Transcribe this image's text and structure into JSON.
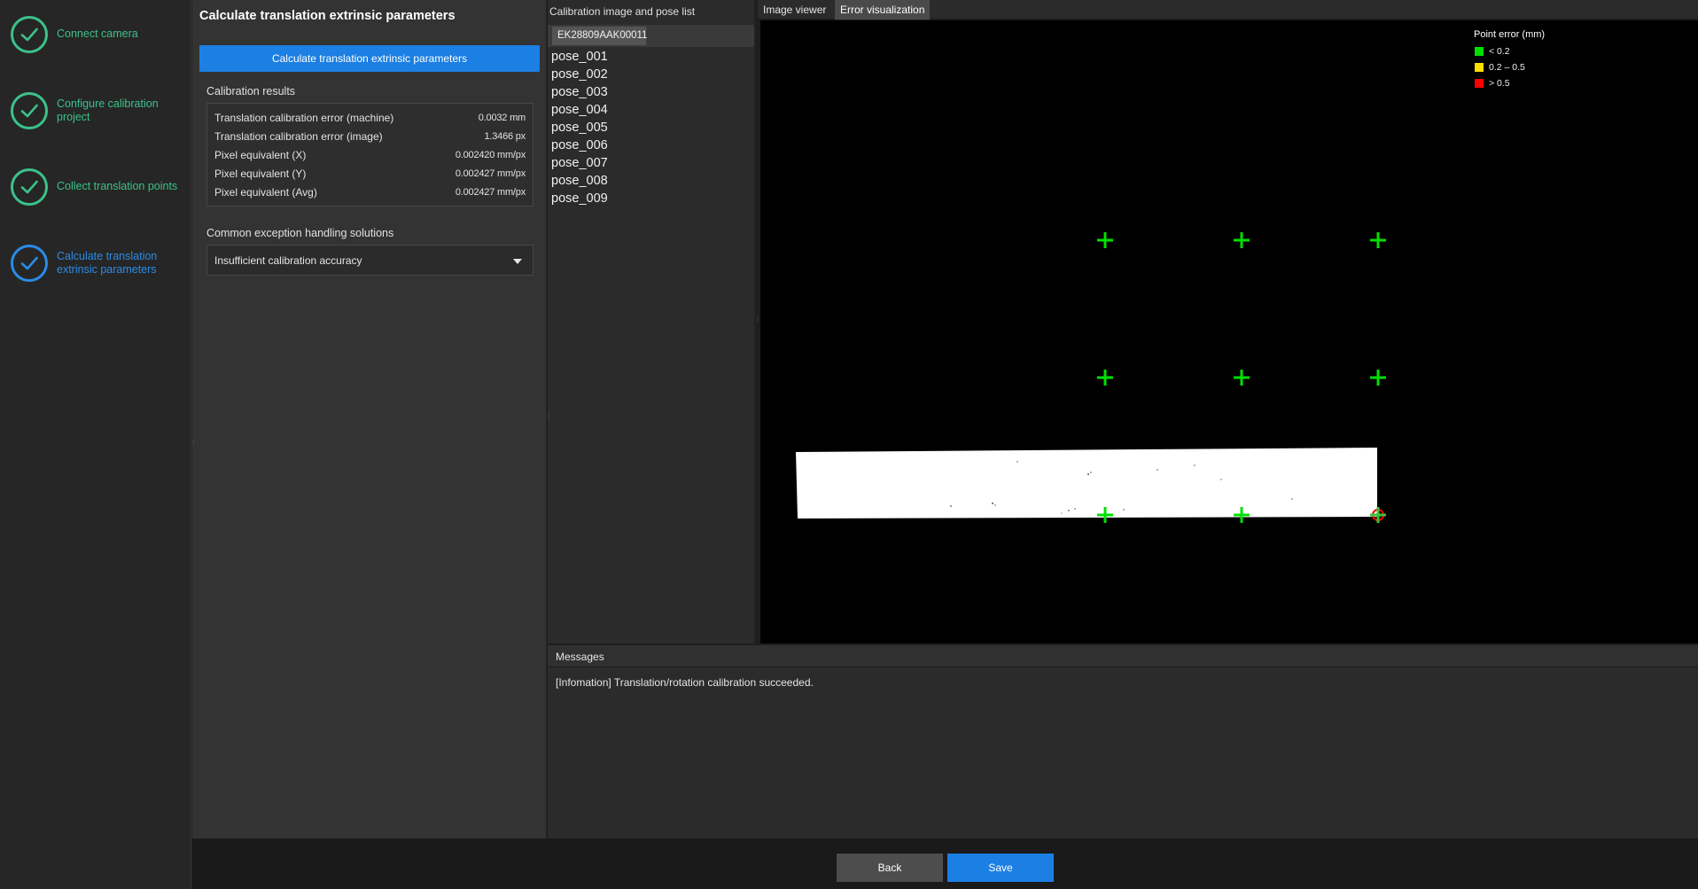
{
  "steps": [
    {
      "label": "Connect camera",
      "state": "done"
    },
    {
      "label": "Configure calibration project",
      "state": "done"
    },
    {
      "label": "Collect translation points",
      "state": "done"
    },
    {
      "label": "Calculate translation extrinsic parameters",
      "state": "current"
    }
  ],
  "params": {
    "title": "Calculate translation extrinsic parameters",
    "calc_button_label": "Calculate translation extrinsic parameters",
    "results_title": "Calibration results",
    "results": [
      {
        "label": "Translation calibration error (machine)",
        "value": "0.0032 mm"
      },
      {
        "label": "Translation calibration error (image)",
        "value": "1.3466 px"
      },
      {
        "label": "Pixel equivalent (X)",
        "value": "0.002420 mm/px"
      },
      {
        "label": "Pixel equivalent (Y)",
        "value": "0.002427 mm/px"
      },
      {
        "label": "Pixel equivalent (Avg)",
        "value": "0.002427 mm/px"
      }
    ],
    "exceptions_title": "Common exception handling solutions",
    "exceptions_selected": "Insufficient calibration accuracy"
  },
  "pose_panel": {
    "title": "Calibration image and pose list",
    "camera_tab": "EK28809AAK00011",
    "poses": [
      "pose_001",
      "pose_002",
      "pose_003",
      "pose_004",
      "pose_005",
      "pose_006",
      "pose_007",
      "pose_008",
      "pose_009"
    ]
  },
  "viewer": {
    "tabs": [
      {
        "label": "Image viewer",
        "active": false
      },
      {
        "label": "Error visualization",
        "active": true
      }
    ],
    "legend": {
      "title": "Point error (mm)",
      "items": [
        {
          "label": "< 0.2",
          "color": "#00e000"
        },
        {
          "label": "0.2 – 0.5",
          "color": "#ffe000"
        },
        {
          "label": "> 0.5",
          "color": "#ff0000"
        }
      ]
    },
    "points": [
      {
        "row": 0,
        "col": 0,
        "level": "low"
      },
      {
        "row": 0,
        "col": 1,
        "level": "low"
      },
      {
        "row": 0,
        "col": 2,
        "level": "low"
      },
      {
        "row": 1,
        "col": 0,
        "level": "low"
      },
      {
        "row": 1,
        "col": 1,
        "level": "low"
      },
      {
        "row": 1,
        "col": 2,
        "level": "low"
      },
      {
        "row": 2,
        "col": 0,
        "level": "low"
      },
      {
        "row": 2,
        "col": 1,
        "level": "low"
      },
      {
        "row": 2,
        "col": 2,
        "level": "high"
      }
    ]
  },
  "messages": {
    "title": "Messages",
    "lines": [
      "[Infomation] Translation/rotation calibration succeeded."
    ]
  },
  "footer": {
    "back_label": "Back",
    "save_label": "Save"
  },
  "colors": {
    "accent_blue": "#1b7fe3",
    "done_green": "#3cc18b",
    "point_low": "#00e000",
    "point_high": "#ff0000"
  }
}
